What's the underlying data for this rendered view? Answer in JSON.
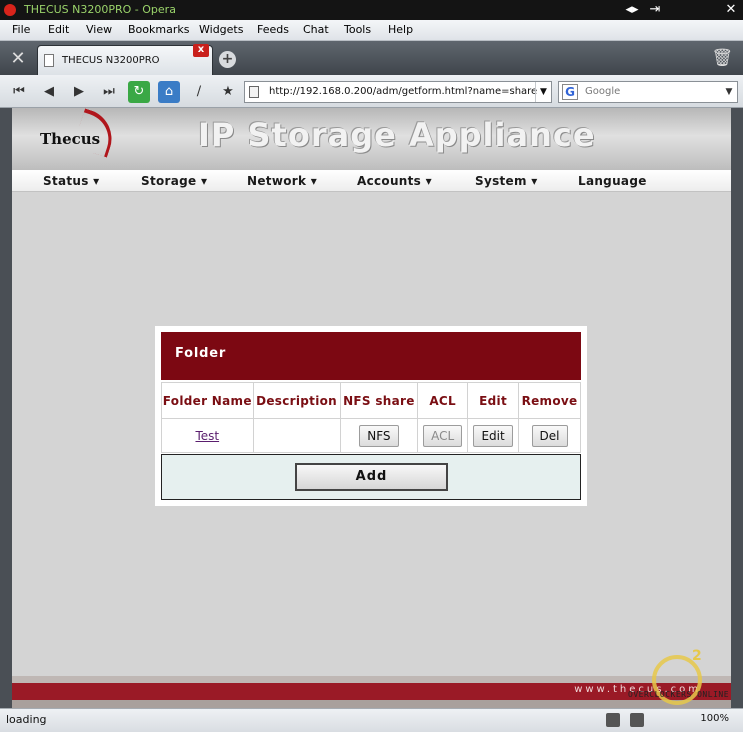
{
  "window": {
    "title": "THECUS N3200PRO - Opera"
  },
  "menu": {
    "items": [
      "File",
      "Edit",
      "View",
      "Bookmarks",
      "Widgets",
      "Feeds",
      "Chat",
      "Tools",
      "Help"
    ]
  },
  "tab": {
    "title": "THECUS N3200PRO",
    "close": "x"
  },
  "address": {
    "url": "http://192.168.0.200/adm/getform.html?name=share",
    "search_placeholder": "Google"
  },
  "page": {
    "logo": "Thecus",
    "headline": "IP Storage Appliance",
    "nav": [
      "Status",
      "Storage",
      "Network",
      "Accounts",
      "System",
      "Language"
    ],
    "panel_title": "Folder",
    "columns": [
      "Folder Name",
      "Description",
      "NFS share",
      "ACL",
      "Edit",
      "Remove"
    ],
    "rows": [
      {
        "name": "Test",
        "description": "",
        "nfs": "NFS",
        "acl": "ACL",
        "edit": "Edit",
        "remove": "Del"
      }
    ],
    "add_label": "Add",
    "footer": "www.thecus.com"
  },
  "status": {
    "text": "loading",
    "zoom": "100%"
  },
  "watermark": "OVERCLOCKERS ONLINE",
  "colors": {
    "panel_header": "#7c0812",
    "column_header_text": "#7a0e13",
    "footer": "#9a1a26"
  }
}
